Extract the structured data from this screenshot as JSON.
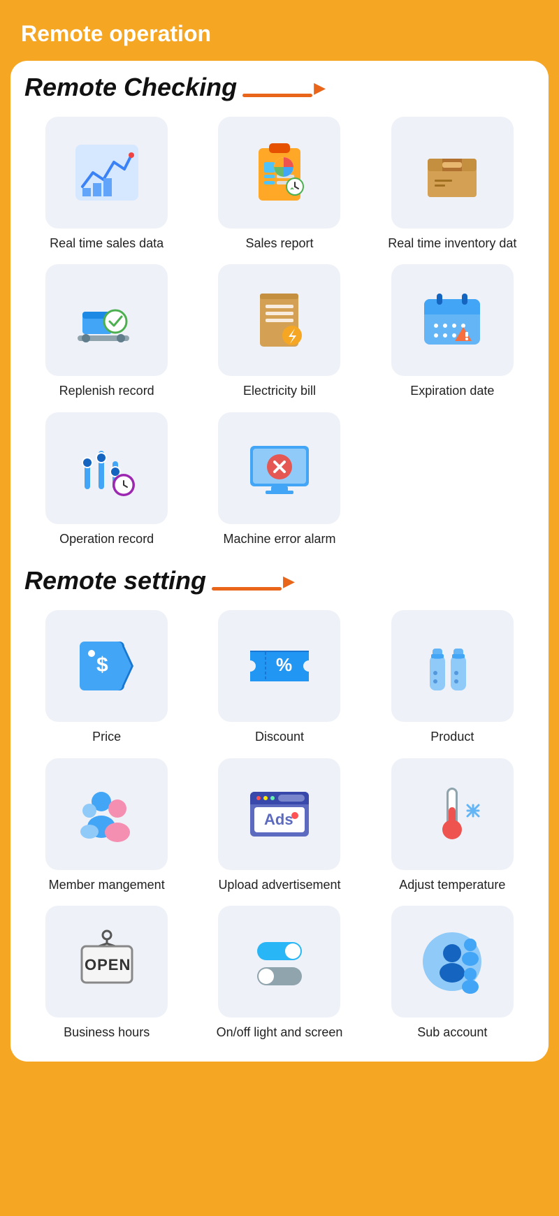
{
  "header": {
    "title": "Remote operation"
  },
  "sections": [
    {
      "id": "remote-checking",
      "title": "Remote Checking",
      "items": [
        {
          "id": "real-time-sales",
          "label": "Real time sales data",
          "icon": "chart"
        },
        {
          "id": "sales-report",
          "label": "Sales report",
          "icon": "clipboard"
        },
        {
          "id": "real-time-inventory",
          "label": "Real time inventory dat",
          "icon": "box"
        },
        {
          "id": "replenish-record",
          "label": "Replenish record",
          "icon": "conveyor"
        },
        {
          "id": "electricity-bill",
          "label": "Electricity bill",
          "icon": "bill"
        },
        {
          "id": "expiration-date",
          "label": "Expiration date",
          "icon": "calendar"
        },
        {
          "id": "operation-record",
          "label": "Operation record",
          "icon": "sliders"
        },
        {
          "id": "machine-error",
          "label": "Machine error alarm",
          "icon": "monitor-error"
        }
      ]
    },
    {
      "id": "remote-setting",
      "title": "Remote setting",
      "items": [
        {
          "id": "price",
          "label": "Price",
          "icon": "price-tag"
        },
        {
          "id": "discount",
          "label": "Discount",
          "icon": "coupon"
        },
        {
          "id": "product",
          "label": "Product",
          "icon": "bottles"
        },
        {
          "id": "member",
          "label": "Member mangement",
          "icon": "members"
        },
        {
          "id": "advertisement",
          "label": "Upload advertisement",
          "icon": "ads"
        },
        {
          "id": "temperature",
          "label": "Adjust temperature",
          "icon": "thermometer"
        },
        {
          "id": "business-hours",
          "label": "Business hours",
          "icon": "open-sign"
        },
        {
          "id": "light-screen",
          "label": "On/off light and screen",
          "icon": "toggle"
        },
        {
          "id": "sub-account",
          "label": "Sub account",
          "icon": "accounts"
        }
      ]
    }
  ],
  "colors": {
    "bg": "#F5A623",
    "card": "#ffffff",
    "iconBg": "#EEF2F8",
    "titleAccent": "#E8651A",
    "textDark": "#111111",
    "textLabel": "#222222"
  }
}
